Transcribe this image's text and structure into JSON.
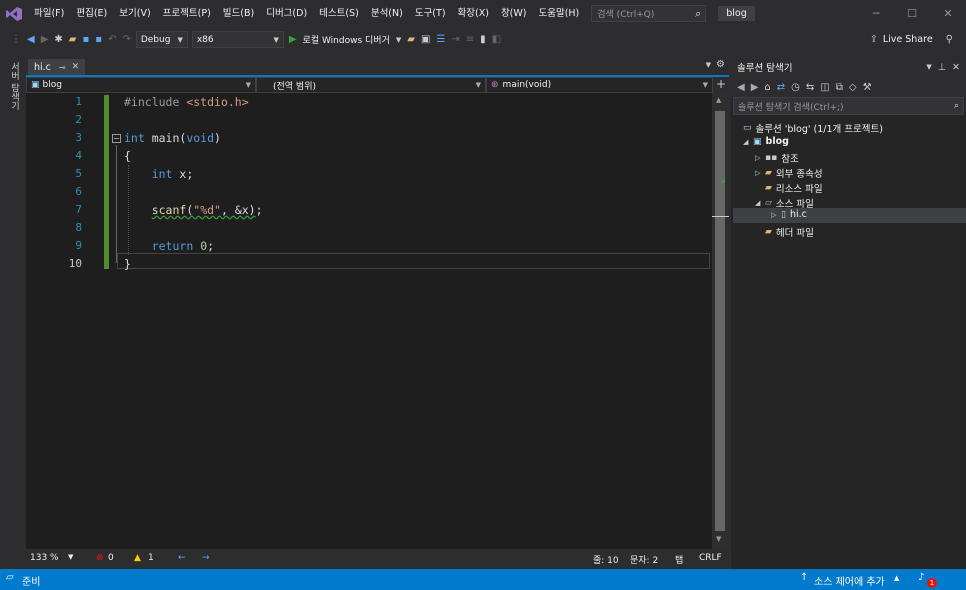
{
  "menubar": {
    "items": [
      "파일(F)",
      "편집(E)",
      "보기(V)",
      "프로젝트(P)",
      "빌드(B)",
      "디버그(D)",
      "테스트(S)",
      "분석(N)",
      "도구(T)",
      "확장(X)",
      "창(W)",
      "도움말(H)"
    ],
    "search_placeholder": "검색 (Ctrl+Q)",
    "project_badge": "blog"
  },
  "toolbar": {
    "config": "Debug",
    "platform": "x86",
    "run_label": "로컬 Windows 디버거",
    "live_share": "Live Share"
  },
  "side_strip": {
    "label": "서버 탐색기"
  },
  "tabs": [
    {
      "label": "hi.c"
    }
  ],
  "navbar": {
    "project": "blog",
    "scope": "(전역 범위)",
    "member": "main(void)"
  },
  "editor": {
    "line_numbers": [
      "1",
      "2",
      "3",
      "4",
      "5",
      "6",
      "7",
      "8",
      "9",
      "10"
    ]
  },
  "status_row": {
    "zoom": "133 %",
    "errors": "0",
    "warnings": "1",
    "line": "줄: 10",
    "col": "문자: 2",
    "tab": "탭",
    "eol": "CRLF"
  },
  "solution_explorer": {
    "title": "솔루션 탐색기",
    "search_placeholder": "솔루션 탐색기 검색(Ctrl+;)",
    "solution": "솔루션 'blog' (1/1개 프로젝트)",
    "project": "blog",
    "references": "참조",
    "external": "외부 종속성",
    "resources": "리소스 파일",
    "sources": "소스 파일",
    "file": "hi.c",
    "headers": "헤더 파일"
  },
  "statusbar": {
    "ready": "준비",
    "source_control": "소스 제어에 추가",
    "notifications": "1"
  },
  "colors": {
    "accent": "#007acc",
    "editor_bg": "#1e1e1e",
    "keyword": "#569cd6",
    "string": "#d69d85",
    "line_number": "#2b91af"
  }
}
